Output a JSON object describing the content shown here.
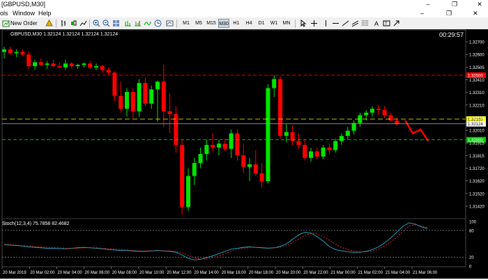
{
  "window": {
    "title": "[GBPUSD,M30]",
    "min": "–",
    "restore": "❐",
    "close": "✕"
  },
  "menu": {
    "items": [
      "ols",
      "Window",
      "Help"
    ],
    "right": [
      "–",
      "❐",
      "✕"
    ]
  },
  "toolbar": {
    "new_order": "New Order",
    "timeframes": [
      "M1",
      "M5",
      "M15",
      "M30",
      "H1",
      "H4",
      "D1",
      "W1",
      "MN"
    ],
    "active_timeframe": "M30"
  },
  "chart": {
    "header": "GBPUSD,M30  1.32124 1.32124 1.32124 1.32124",
    "timer": "00:29:57",
    "indicator_label": "Stoch(12,3,4) 75.7858 82.4682",
    "colors": {
      "bull": "#00e600",
      "bear": "#ff0000",
      "resistance": "#ff0000",
      "pivot": "#ffff00",
      "support": "#00d000",
      "bid": "#8a9bb0"
    },
    "levels": {
      "resistance": 1.325,
      "pivot": 1.3216,
      "support": 1.32,
      "bid": 1.32124
    },
    "level_labels": {
      "resistance": "1.32500",
      "pivot": "1.32160",
      "support": "1.32000",
      "bid": "1.32124"
    }
  },
  "chart_data": {
    "type": "candlestick",
    "symbol": "GBPUSD",
    "timeframe": "M30",
    "ylim": [
      1.314,
      1.3278
    ],
    "y_ticks": [
      "1.32700",
      "1.32600",
      "1.32505",
      "1.32410",
      "1.32310",
      "1.32210",
      "1.32120",
      "1.32010",
      "1.31915",
      "1.31815",
      "1.31720",
      "1.31620",
      "1.31520",
      "1.31420"
    ],
    "x_ticks": [
      "20 Mar 2019",
      "20 Mar 02:00",
      "20 Mar 04:00",
      "20 Mar 06:00",
      "20 Mar 08:00",
      "20 Mar 10:00",
      "20 Mar 12:00",
      "20 Mar 14:00",
      "20 Mar 16:00",
      "20 Mar 18:00",
      "20 Mar 20:00",
      "20 Mar 22:00",
      "21 Mar 00:00",
      "21 Mar 02:00",
      "21 Mar 04:00",
      "21 Mar 06:00"
    ],
    "candles": [
      {
        "o": 1.3268,
        "h": 1.3272,
        "l": 1.3263,
        "c": 1.327
      },
      {
        "o": 1.327,
        "h": 1.3272,
        "l": 1.3266,
        "c": 1.3267
      },
      {
        "o": 1.3267,
        "h": 1.327,
        "l": 1.3264,
        "c": 1.3268
      },
      {
        "o": 1.3268,
        "h": 1.327,
        "l": 1.3265,
        "c": 1.3266
      },
      {
        "o": 1.3266,
        "h": 1.3268,
        "l": 1.3255,
        "c": 1.3257
      },
      {
        "o": 1.3257,
        "h": 1.3262,
        "l": 1.3254,
        "c": 1.326
      },
      {
        "o": 1.326,
        "h": 1.3263,
        "l": 1.3257,
        "c": 1.3258
      },
      {
        "o": 1.3258,
        "h": 1.3261,
        "l": 1.3255,
        "c": 1.3259
      },
      {
        "o": 1.3259,
        "h": 1.3262,
        "l": 1.3256,
        "c": 1.3257
      },
      {
        "o": 1.3257,
        "h": 1.326,
        "l": 1.3255,
        "c": 1.3256
      },
      {
        "o": 1.3256,
        "h": 1.3262,
        "l": 1.3254,
        "c": 1.3259
      },
      {
        "o": 1.3259,
        "h": 1.326,
        "l": 1.3255,
        "c": 1.3257
      },
      {
        "o": 1.3257,
        "h": 1.3259,
        "l": 1.3255,
        "c": 1.3258
      },
      {
        "o": 1.3258,
        "h": 1.326,
        "l": 1.3256,
        "c": 1.3259
      },
      {
        "o": 1.3259,
        "h": 1.3261,
        "l": 1.3255,
        "c": 1.3256
      },
      {
        "o": 1.3256,
        "h": 1.3259,
        "l": 1.3254,
        "c": 1.3257
      },
      {
        "o": 1.3257,
        "h": 1.3258,
        "l": 1.3252,
        "c": 1.3254
      },
      {
        "o": 1.3254,
        "h": 1.3256,
        "l": 1.325,
        "c": 1.3252
      },
      {
        "o": 1.3252,
        "h": 1.3253,
        "l": 1.323,
        "c": 1.3234
      },
      {
        "o": 1.3234,
        "h": 1.3245,
        "l": 1.3221,
        "c": 1.3224
      },
      {
        "o": 1.3224,
        "h": 1.324,
        "l": 1.3218,
        "c": 1.3237
      },
      {
        "o": 1.3237,
        "h": 1.324,
        "l": 1.3217,
        "c": 1.3222
      },
      {
        "o": 1.3222,
        "h": 1.3247,
        "l": 1.3218,
        "c": 1.3244
      },
      {
        "o": 1.3244,
        "h": 1.3248,
        "l": 1.3226,
        "c": 1.3228
      },
      {
        "o": 1.3228,
        "h": 1.3242,
        "l": 1.3224,
        "c": 1.3239
      },
      {
        "o": 1.3239,
        "h": 1.3246,
        "l": 1.3214,
        "c": 1.3245
      },
      {
        "o": 1.3245,
        "h": 1.3258,
        "l": 1.321,
        "c": 1.3222
      },
      {
        "o": 1.3222,
        "h": 1.3236,
        "l": 1.3205,
        "c": 1.322
      },
      {
        "o": 1.322,
        "h": 1.3226,
        "l": 1.319,
        "c": 1.3196
      },
      {
        "o": 1.3196,
        "h": 1.32,
        "l": 1.3142,
        "c": 1.3148
      },
      {
        "o": 1.3148,
        "h": 1.3178,
        "l": 1.3145,
        "c": 1.3172
      },
      {
        "o": 1.3172,
        "h": 1.3186,
        "l": 1.3165,
        "c": 1.3182
      },
      {
        "o": 1.3182,
        "h": 1.3194,
        "l": 1.3178,
        "c": 1.3189
      },
      {
        "o": 1.3189,
        "h": 1.32,
        "l": 1.3184,
        "c": 1.3196
      },
      {
        "o": 1.3196,
        "h": 1.3205,
        "l": 1.3191,
        "c": 1.3194
      },
      {
        "o": 1.3194,
        "h": 1.32,
        "l": 1.3188,
        "c": 1.3197
      },
      {
        "o": 1.3197,
        "h": 1.3201,
        "l": 1.3191,
        "c": 1.3193
      },
      {
        "o": 1.3193,
        "h": 1.3208,
        "l": 1.3186,
        "c": 1.3205
      },
      {
        "o": 1.3205,
        "h": 1.3208,
        "l": 1.3184,
        "c": 1.3188
      },
      {
        "o": 1.3188,
        "h": 1.3197,
        "l": 1.3174,
        "c": 1.3179
      },
      {
        "o": 1.3179,
        "h": 1.3186,
        "l": 1.3168,
        "c": 1.3181
      },
      {
        "o": 1.3181,
        "h": 1.3192,
        "l": 1.3172,
        "c": 1.3174
      },
      {
        "o": 1.3174,
        "h": 1.3182,
        "l": 1.3163,
        "c": 1.3168
      },
      {
        "o": 1.3168,
        "h": 1.3243,
        "l": 1.3166,
        "c": 1.324
      },
      {
        "o": 1.324,
        "h": 1.325,
        "l": 1.3233,
        "c": 1.3247
      },
      {
        "o": 1.3247,
        "h": 1.3249,
        "l": 1.3201,
        "c": 1.3203
      },
      {
        "o": 1.3203,
        "h": 1.3212,
        "l": 1.3198,
        "c": 1.3206
      },
      {
        "o": 1.3206,
        "h": 1.3211,
        "l": 1.3196,
        "c": 1.3199
      },
      {
        "o": 1.3199,
        "h": 1.3205,
        "l": 1.3193,
        "c": 1.3196
      },
      {
        "o": 1.3196,
        "h": 1.32,
        "l": 1.3184,
        "c": 1.3186
      },
      {
        "o": 1.3186,
        "h": 1.3194,
        "l": 1.3183,
        "c": 1.3191
      },
      {
        "o": 1.3191,
        "h": 1.3194,
        "l": 1.3185,
        "c": 1.3187
      },
      {
        "o": 1.3187,
        "h": 1.3196,
        "l": 1.3185,
        "c": 1.3194
      },
      {
        "o": 1.3194,
        "h": 1.3197,
        "l": 1.3189,
        "c": 1.3192
      },
      {
        "o": 1.3192,
        "h": 1.3201,
        "l": 1.319,
        "c": 1.3199
      },
      {
        "o": 1.3199,
        "h": 1.3205,
        "l": 1.3196,
        "c": 1.3203
      },
      {
        "o": 1.3203,
        "h": 1.321,
        "l": 1.32,
        "c": 1.3207
      },
      {
        "o": 1.3207,
        "h": 1.3215,
        "l": 1.3204,
        "c": 1.3213
      },
      {
        "o": 1.3213,
        "h": 1.3221,
        "l": 1.321,
        "c": 1.3219
      },
      {
        "o": 1.3219,
        "h": 1.3223,
        "l": 1.3215,
        "c": 1.3221
      },
      {
        "o": 1.3221,
        "h": 1.3226,
        "l": 1.3218,
        "c": 1.3224
      },
      {
        "o": 1.3224,
        "h": 1.3227,
        "l": 1.3219,
        "c": 1.3223
      },
      {
        "o": 1.3223,
        "h": 1.3226,
        "l": 1.3217,
        "c": 1.3219
      },
      {
        "o": 1.3219,
        "h": 1.3221,
        "l": 1.3214,
        "c": 1.3215
      },
      {
        "o": 1.3215,
        "h": 1.3217,
        "l": 1.3211,
        "c": 1.3212
      }
    ],
    "projection": [
      1.3215,
      1.3205,
      1.3208,
      1.3199
    ],
    "stoch": {
      "ylim": [
        0,
        100
      ],
      "levels": [
        80,
        20
      ],
      "tick_labels": [
        "100",
        "80",
        "20",
        "0"
      ],
      "main": [
        48,
        47,
        46,
        45,
        43,
        42,
        41,
        40,
        40,
        39,
        39,
        40,
        41,
        42,
        41,
        40,
        39,
        37,
        36,
        35,
        35,
        34,
        33,
        33,
        34,
        35,
        34,
        33,
        31,
        25,
        17,
        14,
        15,
        19,
        23,
        28,
        33,
        38,
        40,
        42,
        43,
        42,
        41,
        40,
        41,
        44,
        50,
        60,
        70,
        76,
        74,
        66,
        56,
        44,
        37,
        34,
        32,
        31,
        31,
        33,
        37,
        43,
        52,
        63,
        76,
        89,
        97,
        94,
        88,
        84
      ],
      "signal": [
        49,
        48,
        47,
        46,
        45,
        44,
        43,
        42,
        41,
        41,
        40,
        40,
        40,
        41,
        41,
        41,
        40,
        39,
        38,
        37,
        36,
        35,
        34,
        34,
        34,
        34,
        34,
        34,
        33,
        30,
        24,
        19,
        16,
        16,
        19,
        23,
        28,
        33,
        37,
        40,
        42,
        42,
        42,
        41,
        41,
        42,
        46,
        53,
        61,
        69,
        73,
        72,
        66,
        58,
        49,
        42,
        37,
        34,
        32,
        32,
        34,
        38,
        45,
        54,
        65,
        78,
        90,
        93,
        90,
        86
      ]
    }
  }
}
